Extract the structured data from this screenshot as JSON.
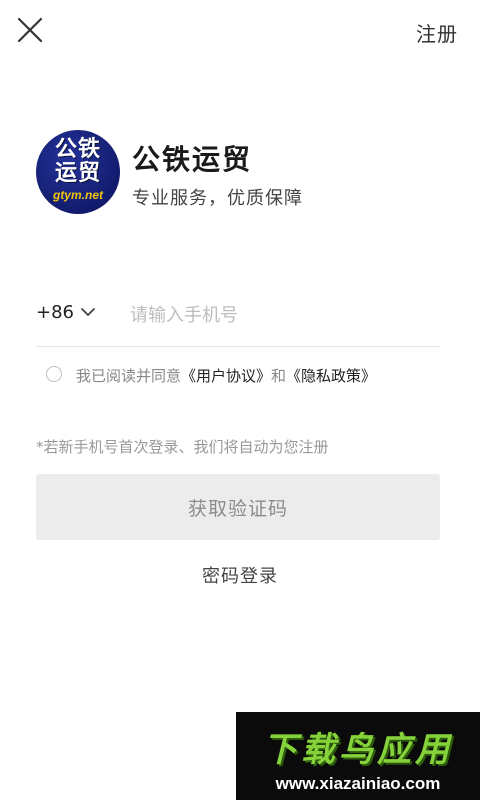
{
  "header": {
    "close_icon": "close-icon",
    "register_label": "注册"
  },
  "brand": {
    "logo_line1": "公铁",
    "logo_line2": "运贸",
    "logo_domain": "gtym.net",
    "title": "公铁运贸",
    "subtitle": "专业服务，优质保障"
  },
  "phone": {
    "country_code": "+86",
    "chevron_icon": "chevron-down-icon",
    "placeholder": "请输入手机号",
    "value": ""
  },
  "agreement": {
    "checked": false,
    "prefix": "我已阅读并同意",
    "user_agreement": "《用户协议》",
    "and": "和",
    "privacy_policy": "《隐私政策》"
  },
  "hint": "*若新手机号首次登录、我们将自动为您注册",
  "buttons": {
    "get_code": "获取验证码",
    "password_login": "密码登录"
  },
  "watermark": {
    "title": "下载鸟应用",
    "url": "www.xiazainiao.com"
  },
  "colors": {
    "logo_bg": "#121c6e",
    "logo_domain": "#f1c40f",
    "button_bg": "#ececec",
    "watermark_green": "#86d23a"
  }
}
